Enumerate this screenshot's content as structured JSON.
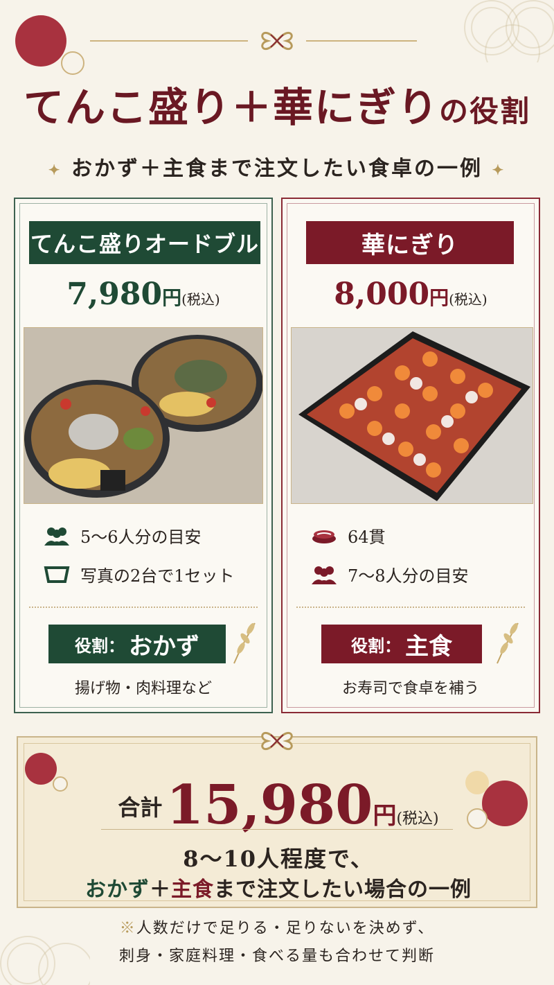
{
  "title": {
    "main": "てんこ盛り＋華にぎり",
    "suffix": "の役割"
  },
  "subtitle": "おかず＋主食まで注文したい食卓の一例",
  "left_card": {
    "label": "てんこ盛りオードブル",
    "price": "7,980",
    "yen": "円",
    "tax": "(税込)",
    "info": [
      {
        "icon": "people-icon",
        "text": "5〜6人分の目安"
      },
      {
        "icon": "tray-icon",
        "text": "写真の2台で1セット"
      }
    ],
    "role_prefix": "役割：",
    "role": "おかず",
    "role_desc": "揚げ物・肉料理など"
  },
  "right_card": {
    "label": "華にぎり",
    "price": "8,000",
    "yen": "円",
    "tax": "(税込)",
    "info": [
      {
        "icon": "sushi-icon",
        "text": "64貫"
      },
      {
        "icon": "people-icon",
        "text": "7〜8人分の目安"
      }
    ],
    "role_prefix": "役割：",
    "role": "主食",
    "role_desc": "お寿司で食卓を補う"
  },
  "total": {
    "label": "合計",
    "amount": "15,980",
    "yen": "円",
    "tax": "(税込)",
    "line1": "8〜10人程度で、",
    "line2_a": "おかず",
    "line2_plus": "＋",
    "line2_b": "主食",
    "line2_rest": "まで注文したい場合の一例"
  },
  "note": {
    "mark": "※",
    "line1": "人数だけで足りる・足りないを決めず、",
    "line2": "刺身・家庭料理・食べる量も合わせて判断"
  },
  "colors": {
    "green": "#1f4a35",
    "red": "#7b1a28",
    "gold": "#c9b48a",
    "bg": "#f7f3ea"
  }
}
